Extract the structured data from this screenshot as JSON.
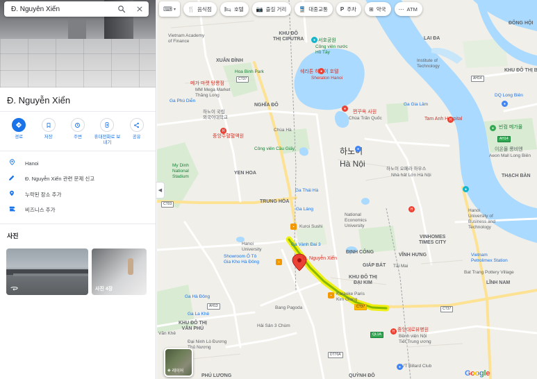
{
  "search": {
    "query": "Đ. Nguyễn Xiển"
  },
  "place": {
    "title": "Đ. Nguyễn Xiển"
  },
  "actions": [
    {
      "label": "경로",
      "icon": "directions-icon"
    },
    {
      "label": "저장",
      "icon": "bookmark-icon"
    },
    {
      "label": "주변",
      "icon": "nearby-icon"
    },
    {
      "label": "휴대전화로 보내기",
      "icon": "send-to-phone-icon"
    },
    {
      "label": "공유",
      "icon": "share-icon"
    }
  ],
  "info": [
    {
      "text": "Hanoi",
      "icon": "location-pin-icon"
    },
    {
      "text": "Đ. Nguyễn Xiển 관련 문제 신고",
      "icon": "edit-pencil-icon"
    },
    {
      "text": "누락된 장소 추가",
      "icon": "add-place-icon"
    },
    {
      "text": "비즈니스 추가",
      "icon": "add-business-icon"
    }
  ],
  "photos": {
    "title": "사진",
    "second_caption": "사진 4장"
  },
  "chips": [
    {
      "label": "음식점",
      "icon": "restaurant-icon"
    },
    {
      "label": "호텔",
      "icon": "hotel-icon"
    },
    {
      "label": "즐길 거리",
      "icon": "camera-icon"
    },
    {
      "label": "대중교통",
      "icon": "transit-icon"
    },
    {
      "label": "주차",
      "icon": "parking-icon"
    },
    {
      "label": "약국",
      "icon": "pharmacy-icon"
    },
    {
      "label": "ATM",
      "icon": "more-icon"
    }
  ],
  "layer_button": {
    "label": "레이어"
  },
  "map": {
    "city_ko": "하노이",
    "city_vi": "Hà Nội",
    "pin_label": "Đ. Nguyễn Xiển",
    "labels": {
      "khu_do_thi_ciputra": "KHU ĐÔ\nTHỊ CIPUTRA",
      "ho_tay_ko": "서호공원",
      "ho_tay": "Công viên nước\nHồ Tây",
      "lai_da": "LAI ĐA",
      "dong_hoi": "ĐÔNG HỘI",
      "sheraton_ko": "쉐라톤 하노이 호텔",
      "sheraton": "Sheraton Hanoi",
      "vietnam_academy": "Vietnam Academy\nof Finance",
      "xuan_dinh": "XUÂN ĐỈNH",
      "hoa_binh_park": "Hoa Binh Park",
      "mega_market_ko": "메가 마켓 탕롱점",
      "mega_market": "MM Mega Market\nThăng Long",
      "ga_phu_dien": "Ga Phú Diễn",
      "nghia_do": "NGHĨA ĐÔ",
      "quoc_thanh_ko": "쩐꾸옥 사원",
      "quoc_thanh": "Chùa Trấn Quốc",
      "ga_gia_lam": "Ga Gia Lâm",
      "tam_anh": "Tam Anh Hospital",
      "national_uni_ko": "하노이 국립\n외국어대학교",
      "chua_ha": "Chùa Hà",
      "cong_vien_cau_giay": "Công viên Cầu Giấy",
      "hanoi_hospital": "중앙수혈혈액원",
      "my_dinh": "My Dinh\nNational\nStadium",
      "yen_hoa": "YEN HOA",
      "trung_hoa": "TRUNG HÒA",
      "ga_thai_ha": "Ga Thái Hà",
      "ga_lang": "Ga Láng",
      "kuroi_sushi": "Kuroi Sushi",
      "national_econ": "National\nEconomics\nUniversity",
      "opera_ko": "하노이 오페라 하우스",
      "opera": "Nhà hát Lớn Hà Nội",
      "vinhomes_times": "VINHOMES\nTIMES CITY",
      "hanoi_uni_business": "Hanoi\nUniversity of\nBusiness and\nTechnology",
      "vincom_ko": "빈컴 메가몰",
      "aeon_ko": "이온몰 롱비엔",
      "aeon": "Aeon Mall Long Biên",
      "hanoi_uni": "Hanoi\nUniversity",
      "ga_vanh_dai_3": "Ga Vành Đai 3",
      "showroom": "Showroom Ô Tô\nGia Kho Hà Đông",
      "dinh_cong": "ĐỊNH CÔNG",
      "tai_mai": "Tài Mai",
      "giap_bat": "GIÁP BÁT",
      "khu_do_thi_dai_kim": "KHU ĐÔ THỊ\nĐẠI KIM",
      "karaoke": "Karaoke Paris\nKim Giang",
      "bang_pagoda": "Bang Pagoda",
      "ha_dong": "Ga Hà Đông",
      "ga_la_khe": "Ga La Khê",
      "van_phuc": "KHU ĐÔ THỊ\nVĂN PHÚ",
      "van_khe": "Văn Khê",
      "ha_san": "Hải Sản 3 Chùm",
      "dai_ninh": "Đại Ninh Lò Đương\nThủ Nương",
      "vt_billard": "VT Billard Club",
      "quynh_do": "QUỲNH ĐÔ",
      "phu_luong": "PHÚ LƯƠNG",
      "vinh_hung": "VĨNH HƯNG",
      "linh_nam": "LĨNH NAM",
      "petrolimex": "Vietnam\nPetrolimex Station",
      "bat_trang": "Bat Trang Pottery Village",
      "gia_lam_hospital": "중앙대로뷰병원",
      "gia_lam_hospital_vi": "Bệnh viện Nội\nTiết Trung ương",
      "long_bien_ko": "DQ Long Biên",
      "lai_da2": "KHU ĐÔ\nTHỊ BẮC",
      "thach_ban": "THẠCH BÀN",
      "institute_tech": "Institute of\nTechnology"
    }
  },
  "logo": {
    "text": "Google"
  }
}
